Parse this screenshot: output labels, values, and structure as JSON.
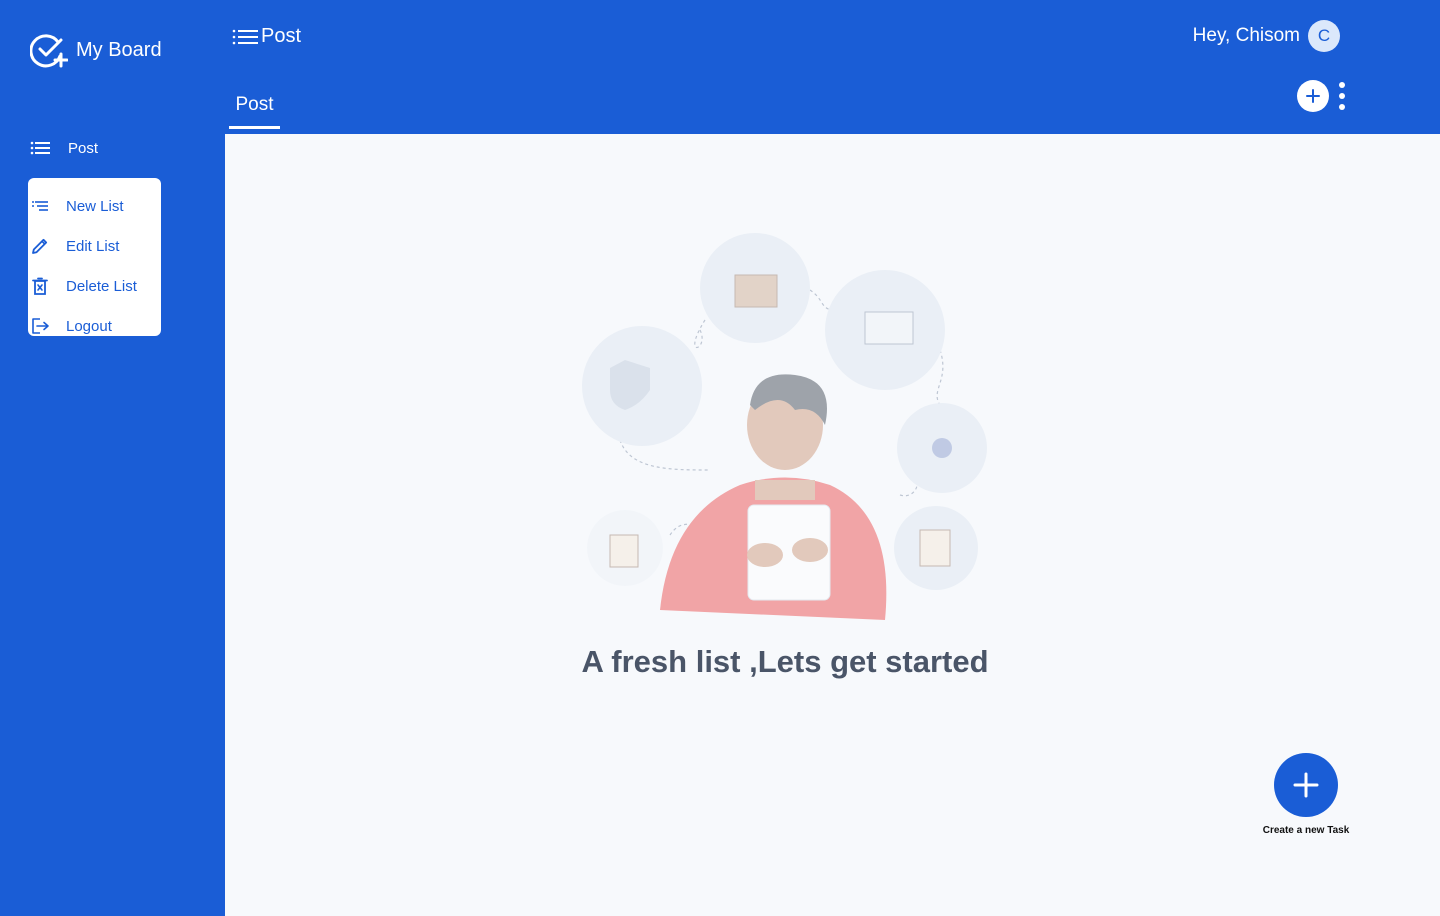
{
  "brand": {
    "name": "My Board"
  },
  "sidebar": {
    "current_list": "Post",
    "menu": [
      {
        "label": "New List",
        "icon": "list-add-icon"
      },
      {
        "label": "Edit List",
        "icon": "pencil-icon"
      },
      {
        "label": "Delete List",
        "icon": "trash-icon"
      },
      {
        "label": "Logout",
        "icon": "logout-icon"
      }
    ]
  },
  "header": {
    "title": "Post",
    "greeting": "Hey, Chisom",
    "avatar_initial": "C",
    "tab": "Post"
  },
  "main": {
    "empty_message": "A fresh list ,Lets get started",
    "fab_label": "Create a new Task"
  },
  "colors": {
    "primary": "#1a5dd6",
    "background": "#f7f9fc",
    "text_dark": "#4a5568"
  }
}
